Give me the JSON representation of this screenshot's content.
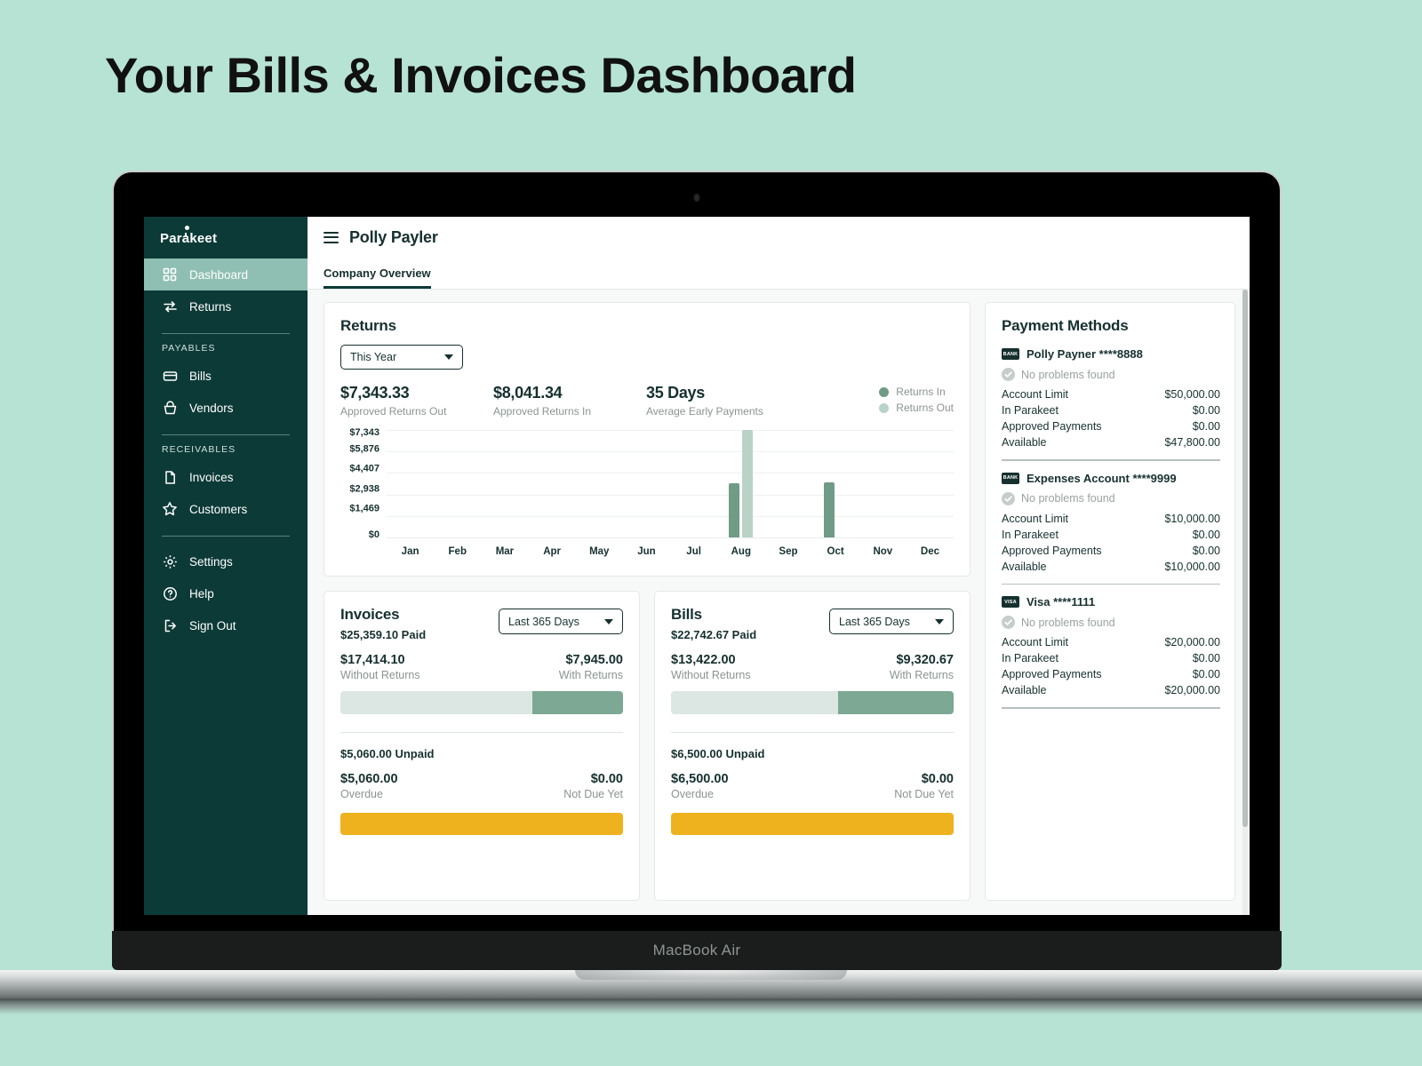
{
  "page": {
    "heading": "Your Bills & Invoices Dashboard",
    "device_label": "MacBook Air",
    "background_color": "#b6e3d4"
  },
  "sidebar": {
    "brand": "Parakeet",
    "items": [
      {
        "label": "Dashboard",
        "icon": "grid-icon",
        "active": true
      },
      {
        "label": "Returns",
        "icon": "exchange-arrows-icon",
        "active": false
      }
    ],
    "groups": [
      {
        "label": "PAYABLES",
        "items": [
          {
            "label": "Bills",
            "icon": "credit-card-icon"
          },
          {
            "label": "Vendors",
            "icon": "basket-icon"
          }
        ]
      },
      {
        "label": "RECEIVABLES",
        "items": [
          {
            "label": "Invoices",
            "icon": "document-icon"
          },
          {
            "label": "Customers",
            "icon": "star-icon"
          }
        ]
      }
    ],
    "footer_items": [
      {
        "label": "Settings",
        "icon": "gear-icon"
      },
      {
        "label": "Help",
        "icon": "question-circle-icon"
      },
      {
        "label": "Sign Out",
        "icon": "sign-out-icon"
      }
    ]
  },
  "topbar": {
    "menu_icon": "hamburger-icon",
    "title": "Polly Payler"
  },
  "tabs": [
    {
      "label": "Company Overview",
      "active": true
    }
  ],
  "returns": {
    "title": "Returns",
    "period_select": {
      "value": "This Year",
      "options": [
        "This Year"
      ]
    },
    "stats": [
      {
        "value": "$7,343.33",
        "label": "Approved Returns Out"
      },
      {
        "value": "$8,041.34",
        "label": "Approved Returns In"
      },
      {
        "value": "35 Days",
        "label": "Average Early Payments"
      }
    ],
    "legend": [
      {
        "label": "Returns In",
        "color": "#6f9b87"
      },
      {
        "label": "Returns Out",
        "color": "#b9d3c7"
      }
    ]
  },
  "chart_data": {
    "type": "bar",
    "title": "Returns",
    "xlabel": "",
    "ylabel": "",
    "categories": [
      "Jan",
      "Feb",
      "Mar",
      "Apr",
      "May",
      "Jun",
      "Jul",
      "Aug",
      "Sep",
      "Oct",
      "Nov",
      "Dec"
    ],
    "ytick_labels": [
      "$7,343",
      "$5,876",
      "$4,407",
      "$2,938",
      "$1,469",
      "$0"
    ],
    "ylim": [
      0,
      7343
    ],
    "grid": true,
    "legend_position": "top-right",
    "series": [
      {
        "name": "Returns In",
        "color": "#6f9b87",
        "values": [
          0,
          0,
          0,
          0,
          0,
          0,
          0,
          3700,
          0,
          3750,
          0,
          0
        ]
      },
      {
        "name": "Returns Out",
        "color": "#b9d3c7",
        "values": [
          0,
          0,
          0,
          0,
          0,
          0,
          0,
          7343,
          0,
          0,
          0,
          0
        ]
      }
    ]
  },
  "invoices": {
    "title": "Invoices",
    "paid_summary": "$25,359.10 Paid",
    "range_select": {
      "value": "Last 365 Days",
      "options": [
        "Last 365 Days"
      ]
    },
    "without_returns": {
      "value": "$17,414.10",
      "label": "Without Returns"
    },
    "with_returns": {
      "value": "$7,945.00",
      "label": "With Returns"
    },
    "progress_percent": 68,
    "unpaid_summary": "$5,060.00 Unpaid",
    "overdue": {
      "value": "$5,060.00",
      "label": "Overdue"
    },
    "not_due": {
      "value": "$0.00",
      "label": "Not Due Yet"
    },
    "cta_color": "#efb21f"
  },
  "bills": {
    "title": "Bills",
    "paid_summary": "$22,742.67 Paid",
    "range_select": {
      "value": "Last 365 Days",
      "options": [
        "Last 365 Days"
      ]
    },
    "without_returns": {
      "value": "$13,422.00",
      "label": "Without Returns"
    },
    "with_returns": {
      "value": "$9,320.67",
      "label": "With Returns"
    },
    "progress_percent": 59,
    "unpaid_summary": "$6,500.00 Unpaid",
    "overdue": {
      "value": "$6,500.00",
      "label": "Overdue"
    },
    "not_due": {
      "value": "$0.00",
      "label": "Not Due Yet"
    },
    "cta_color": "#efb21f"
  },
  "payment_methods": {
    "title": "Payment Methods",
    "accounts": [
      {
        "chip": "BANK",
        "name": "Polly Payner ****8888",
        "status": "No problems found",
        "rows": [
          {
            "label": "Account Limit",
            "value": "$50,000.00"
          },
          {
            "label": "In Parakeet",
            "value": "$0.00"
          },
          {
            "label": "Approved Payments",
            "value": "$0.00"
          },
          {
            "label": "Available",
            "value": "$47,800.00"
          }
        ]
      },
      {
        "chip": "BANK",
        "name": "Expenses Account ****9999",
        "status": "No problems found",
        "rows": [
          {
            "label": "Account Limit",
            "value": "$10,000.00"
          },
          {
            "label": "In Parakeet",
            "value": "$0.00"
          },
          {
            "label": "Approved Payments",
            "value": "$0.00"
          },
          {
            "label": "Available",
            "value": "$10,000.00"
          }
        ]
      },
      {
        "chip": "VISA",
        "name": "Visa ****1111",
        "status": "No problems found",
        "rows": [
          {
            "label": "Account Limit",
            "value": "$20,000.00"
          },
          {
            "label": "In Parakeet",
            "value": "$0.00"
          },
          {
            "label": "Approved Payments",
            "value": "$0.00"
          },
          {
            "label": "Available",
            "value": "$20,000.00"
          }
        ]
      }
    ]
  }
}
